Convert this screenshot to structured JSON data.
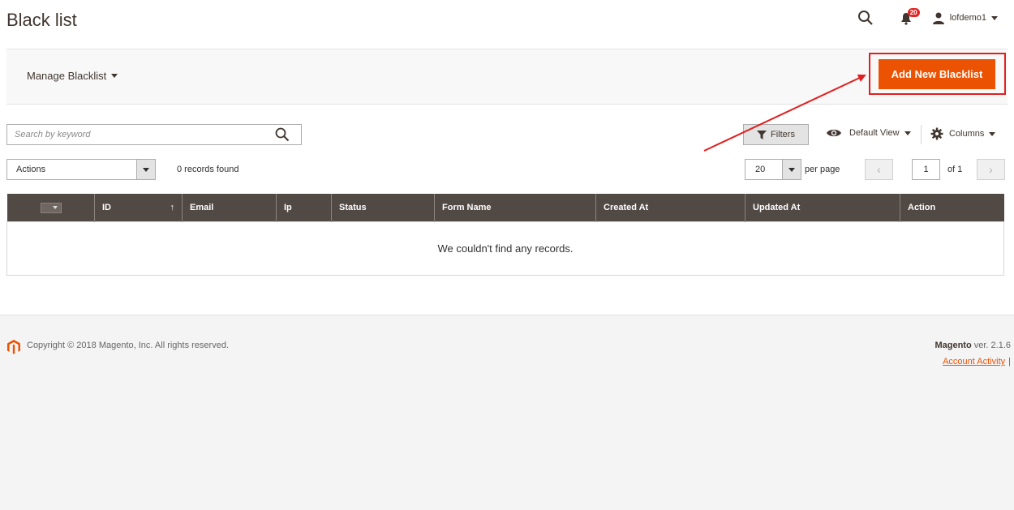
{
  "header": {
    "title": "Black list",
    "notifications_count": "20",
    "username": "lofdemo1"
  },
  "actions_bar": {
    "store_switcher_label": "Manage Blacklist",
    "add_button_label": "Add New Blacklist"
  },
  "toolbar": {
    "search_placeholder": "Search by keyword",
    "filters_label": "Filters",
    "view_label": "Default View",
    "columns_label": "Columns",
    "actions_label": "Actions",
    "records_found": "0 records found",
    "per_page_value": "20",
    "per_page_label": "per page",
    "current_page": "1",
    "total_pages_label": "of 1"
  },
  "grid": {
    "columns": {
      "id": "ID",
      "email": "Email",
      "ip": "Ip",
      "status": "Status",
      "form_name": "Form Name",
      "created_at": "Created At",
      "updated_at": "Updated At",
      "action": "Action"
    },
    "sort_indicator": "↑",
    "empty_message": "We couldn't find any records."
  },
  "footer": {
    "copyright": "Copyright © 2018 Magento, Inc. All rights reserved.",
    "brand": "Magento",
    "version": " ver. 2.1.6",
    "account_activity": "Account Activity",
    "separator": "|"
  },
  "colors": {
    "accent": "#eb5202",
    "grid_header": "#514943",
    "highlight": "#e02020"
  }
}
